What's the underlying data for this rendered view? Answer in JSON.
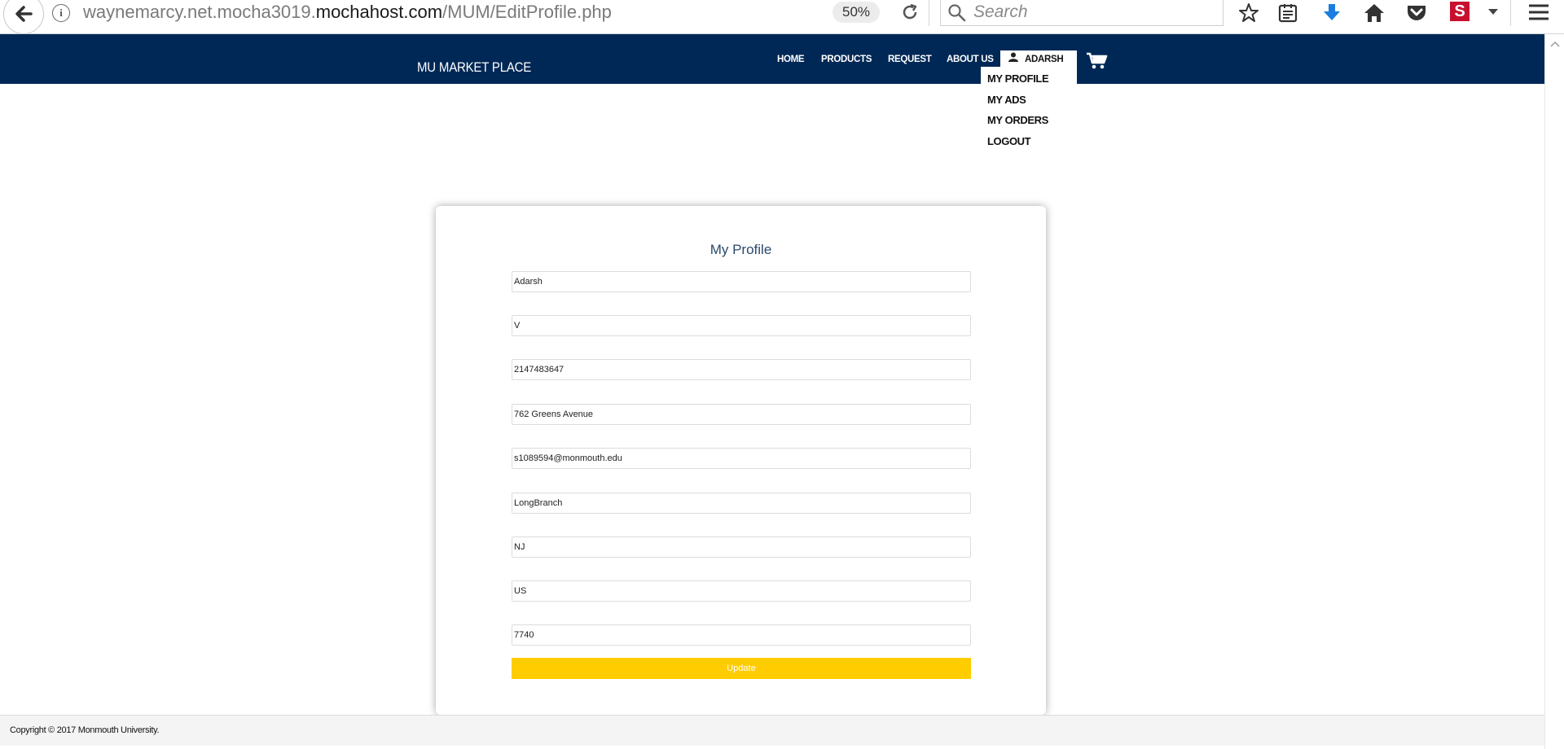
{
  "browser": {
    "url_prefix": "waynemarcy.net.mocha3019.",
    "url_domain": "mochahost.com",
    "url_path": "/MUM/EditProfile.php",
    "zoom": "50%",
    "search_placeholder": "Search"
  },
  "navbar": {
    "brand": "MU MARKET PLACE",
    "items": [
      "HOME",
      "PRODUCTS",
      "REQUEST",
      "ABOUT US"
    ],
    "user_name": "ADARSH",
    "bg_color": "#002856"
  },
  "user_dropdown": {
    "items": [
      "MY PROFILE",
      "MY ADS",
      "MY ORDERS",
      "LOGOUT"
    ]
  },
  "profile": {
    "title": "My Profile",
    "fields": [
      "Adarsh",
      "V",
      "2147483647",
      "762 Greens Avenue",
      "s1089594@monmouth.edu",
      "LongBranch",
      "NJ",
      "US",
      "7740"
    ],
    "update_label": "Update",
    "button_color": "#ffcc00"
  },
  "footer": {
    "copyright": "Copyright © 2017 Monmouth University."
  }
}
